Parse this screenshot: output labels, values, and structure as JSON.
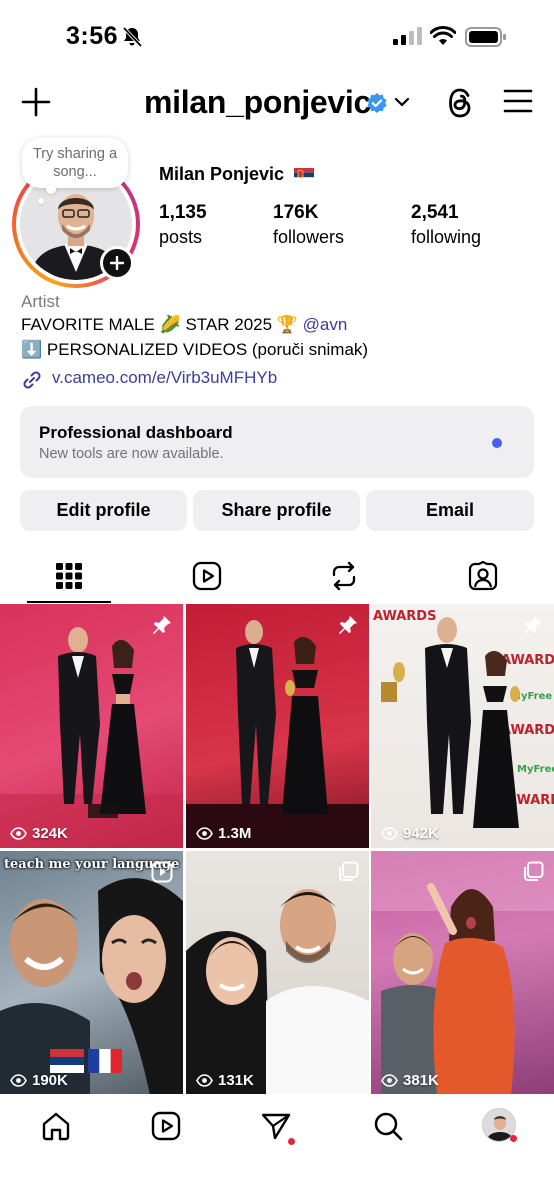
{
  "status_bar": {
    "time": "3:56"
  },
  "header": {
    "username": "milan_ponjevic"
  },
  "profile": {
    "note": "Try sharing a song...",
    "display_name": "Milan Ponjevic",
    "stats": [
      {
        "value": "1,135",
        "label": "posts"
      },
      {
        "value": "176K",
        "label": "followers"
      },
      {
        "value": "2,541",
        "label": "following"
      }
    ],
    "category": "Artist",
    "bio_line1_a": "FAVORITE MALE 🌽 STAR  2025 🏆 ",
    "bio_line1_mention": "@avn",
    "bio_line2": "⬇️ PERSONALIZED VIDEOS (poruči snimak)",
    "link": "v.cameo.com/e/Virb3uMFHYb"
  },
  "dashboard": {
    "title": "Professional dashboard",
    "subtitle": "New tools are now available.",
    "dot_color": "#4b5cf0"
  },
  "buttons": {
    "edit": "Edit profile",
    "share": "Share profile",
    "email": "Email"
  },
  "tabs": [
    "grid-icon",
    "reels-icon",
    "reposts-icon",
    "tagged-icon"
  ],
  "posts": [
    {
      "views": "324K",
      "pinned": true
    },
    {
      "views": "1.3M",
      "pinned": true
    },
    {
      "views": "942K",
      "pinned": true
    },
    {
      "views": "190K",
      "type": "reel",
      "caption": "teach me your language"
    },
    {
      "views": "131K",
      "type": "carousel"
    },
    {
      "views": "381K",
      "type": "carousel"
    }
  ],
  "colors": {
    "accent": "#3d3d9e",
    "notification": "#e3263a",
    "verified": "#3897f0"
  }
}
